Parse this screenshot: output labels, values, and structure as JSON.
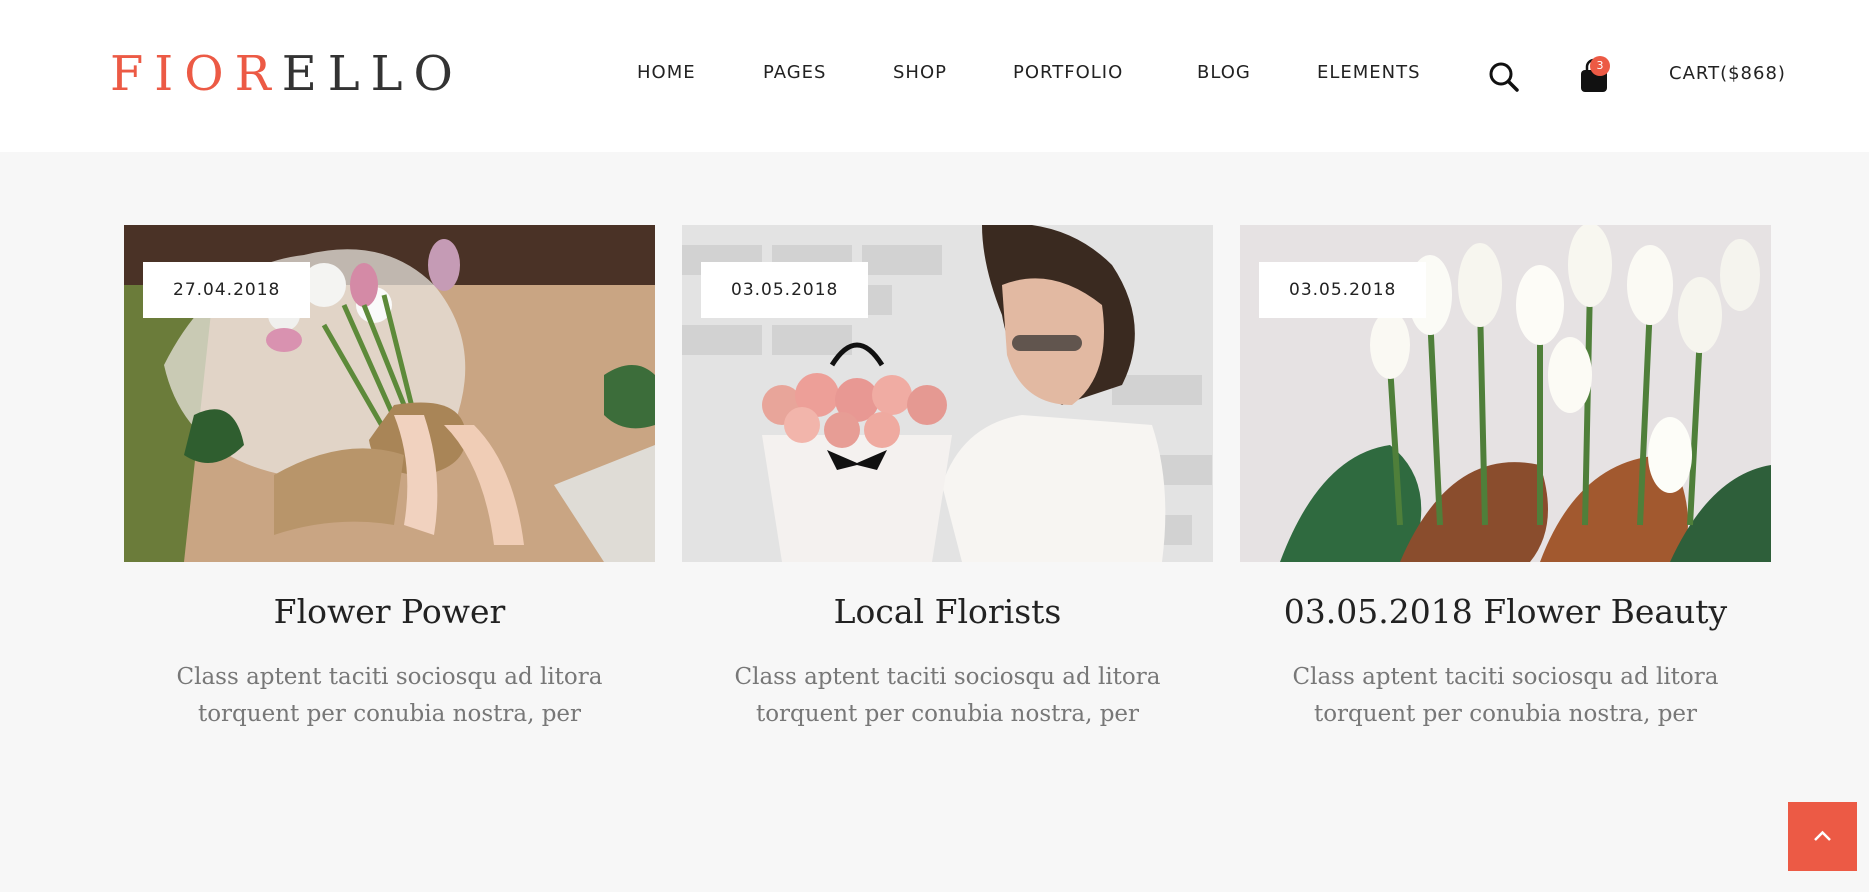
{
  "brand": {
    "logo_accent": "FIOR",
    "logo_rest": "ELLO",
    "accent_color": "#ec5a45"
  },
  "nav": {
    "items": [
      "HOME",
      "PAGES",
      "SHOP",
      "PORTFOLIO",
      "BLOG",
      "ELEMENTS"
    ],
    "search_icon": "search-icon",
    "cart_icon": "shopping-bag-icon",
    "cart_count": "3",
    "cart_label": "CART($868)"
  },
  "posts": [
    {
      "date": "27.04.2018",
      "title": "Flower Power",
      "excerpt": "Class aptent taciti sociosqu ad litora torquent per conubia nostra, per",
      "image": "bouquet-wrapping-photo"
    },
    {
      "date": "03.05.2018",
      "title": "Local Florists",
      "excerpt": "Class aptent taciti sociosqu ad litora torquent per conubia nostra, per",
      "image": "woman-smelling-roses-photo"
    },
    {
      "date": "03.05.2018",
      "title": "03.05.2018 Flower Beauty",
      "excerpt": "Class aptent taciti sociosqu ad litora torquent per conubia nostra, per",
      "image": "white-tulips-photo"
    }
  ],
  "back_to_top_icon": "chevron-up-icon"
}
